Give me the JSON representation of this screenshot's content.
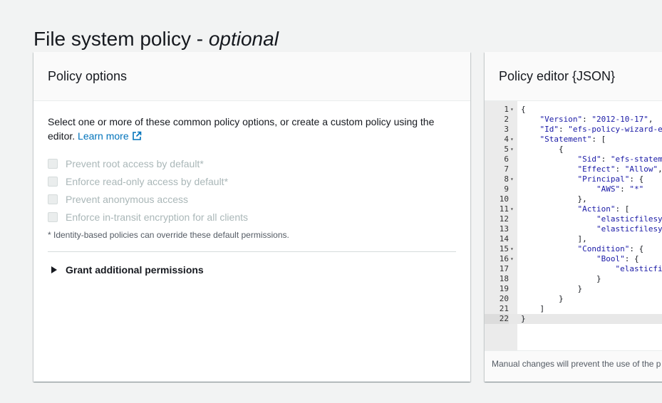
{
  "page": {
    "title_main": "File system policy - ",
    "title_optional": "optional"
  },
  "policy_options": {
    "title": "Policy options",
    "description": "Select one or more of these common policy options, or create a custom policy using the editor.",
    "learn_more": "Learn more",
    "options": [
      {
        "label": "Prevent root access by default*",
        "checked": false,
        "disabled": true
      },
      {
        "label": "Enforce read-only access by default*",
        "checked": false,
        "disabled": true
      },
      {
        "label": "Prevent anonymous access",
        "checked": false,
        "disabled": true
      },
      {
        "label": "Enforce in-transit encryption for all clients",
        "checked": false,
        "disabled": true
      }
    ],
    "footnote": "* Identity-based policies can override these default permissions.",
    "expander_label": "Grant additional permissions"
  },
  "policy_editor": {
    "title": "Policy editor {JSON}",
    "lines": [
      {
        "n": "1",
        "fold": true,
        "text": "{"
      },
      {
        "n": "2",
        "fold": false,
        "text": "    \"Version\": \"2012-10-17\","
      },
      {
        "n": "3",
        "fold": false,
        "text": "    \"Id\": \"efs-policy-wizard-e"
      },
      {
        "n": "4",
        "fold": true,
        "text": "    \"Statement\": ["
      },
      {
        "n": "5",
        "fold": true,
        "text": "        {"
      },
      {
        "n": "6",
        "fold": false,
        "text": "            \"Sid\": \"efs-statem"
      },
      {
        "n": "7",
        "fold": false,
        "text": "            \"Effect\": \"Allow\","
      },
      {
        "n": "8",
        "fold": true,
        "text": "            \"Principal\": {"
      },
      {
        "n": "9",
        "fold": false,
        "text": "                \"AWS\": \"*\""
      },
      {
        "n": "10",
        "fold": false,
        "text": "            },"
      },
      {
        "n": "11",
        "fold": true,
        "text": "            \"Action\": ["
      },
      {
        "n": "12",
        "fold": false,
        "text": "                \"elasticfilesy"
      },
      {
        "n": "13",
        "fold": false,
        "text": "                \"elasticfilesy"
      },
      {
        "n": "14",
        "fold": false,
        "text": "            ],"
      },
      {
        "n": "15",
        "fold": true,
        "text": "            \"Condition\": {"
      },
      {
        "n": "16",
        "fold": true,
        "text": "                \"Bool\": {"
      },
      {
        "n": "17",
        "fold": false,
        "text": "                    \"elasticfi"
      },
      {
        "n": "18",
        "fold": false,
        "text": "                }"
      },
      {
        "n": "19",
        "fold": false,
        "text": "            }"
      },
      {
        "n": "20",
        "fold": false,
        "text": "        }"
      },
      {
        "n": "21",
        "fold": false,
        "text": "    ]"
      },
      {
        "n": "22",
        "fold": false,
        "text": "}"
      }
    ],
    "active_line": 22,
    "footer_message": "Manual changes will prevent the use of the p"
  }
}
